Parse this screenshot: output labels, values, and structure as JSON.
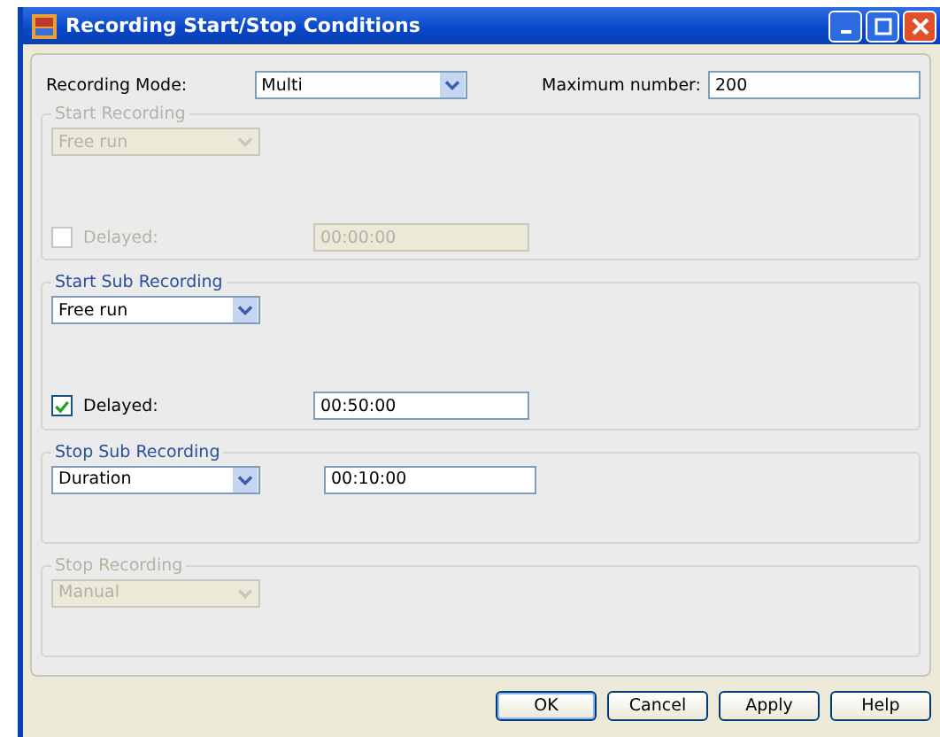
{
  "window": {
    "title": "Recording Start/Stop Conditions"
  },
  "recording_mode": {
    "label": "Recording Mode:",
    "value": "Multi"
  },
  "maximum_number": {
    "label": "Maximum number:",
    "value": "200"
  },
  "groups": [
    {
      "title": "Start Recording",
      "disabled": true,
      "dropdown": "Free run",
      "delayed": {
        "label": "Delayed:",
        "checked": false,
        "value": "00:00:00"
      }
    },
    {
      "title": "Start Sub Recording",
      "disabled": false,
      "dropdown": "Free run",
      "delayed": {
        "label": "Delayed:",
        "checked": true,
        "value": "00:50:00"
      }
    },
    {
      "title": "Stop Sub Recording",
      "disabled": false,
      "dropdown": "Duration",
      "time": "00:10:00"
    },
    {
      "title": "Stop Recording",
      "disabled": true,
      "dropdown": "Manual"
    }
  ],
  "buttons": [
    {
      "label": "OK",
      "default": true
    },
    {
      "label": "Cancel",
      "default": false
    },
    {
      "label": "Apply",
      "default": false
    },
    {
      "label": "Help",
      "default": false
    }
  ]
}
